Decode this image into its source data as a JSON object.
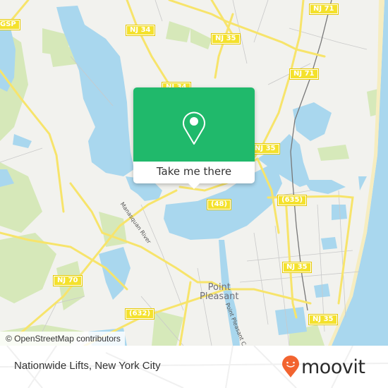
{
  "map": {
    "road_shields": [
      {
        "label": "NJ 71"
      },
      {
        "label": "GSP"
      },
      {
        "label": "NJ 34"
      },
      {
        "label": "NJ 35"
      },
      {
        "label": "NJ 71"
      },
      {
        "label": "NJ 34"
      },
      {
        "label": "NJ 35"
      },
      {
        "label": "(48)"
      },
      {
        "label": "(635)"
      },
      {
        "label": "NJ 35"
      },
      {
        "label": "NJ 70"
      },
      {
        "label": "(632)"
      },
      {
        "label": "NJ 35"
      }
    ],
    "place_label": "Point Pleasant",
    "place_line1": "Point",
    "place_line2": "Pleasant",
    "water_labels": {
      "river": "Manasquan River",
      "canal": "Point Pleasant C"
    },
    "colors": {
      "land": "#f2f2ee",
      "water": "#a9d7ee",
      "park": "#d3e8b4",
      "road": "#f7e46b",
      "popup_green": "#20b96b"
    }
  },
  "popup": {
    "icon": "location-pin-icon",
    "button_label": "Take me there"
  },
  "attribution": "© OpenStreetMap contributors",
  "footer": {
    "title": "Nationwide Lifts, New York City",
    "logo_text": "moovit",
    "logo_color": "#f26430"
  }
}
